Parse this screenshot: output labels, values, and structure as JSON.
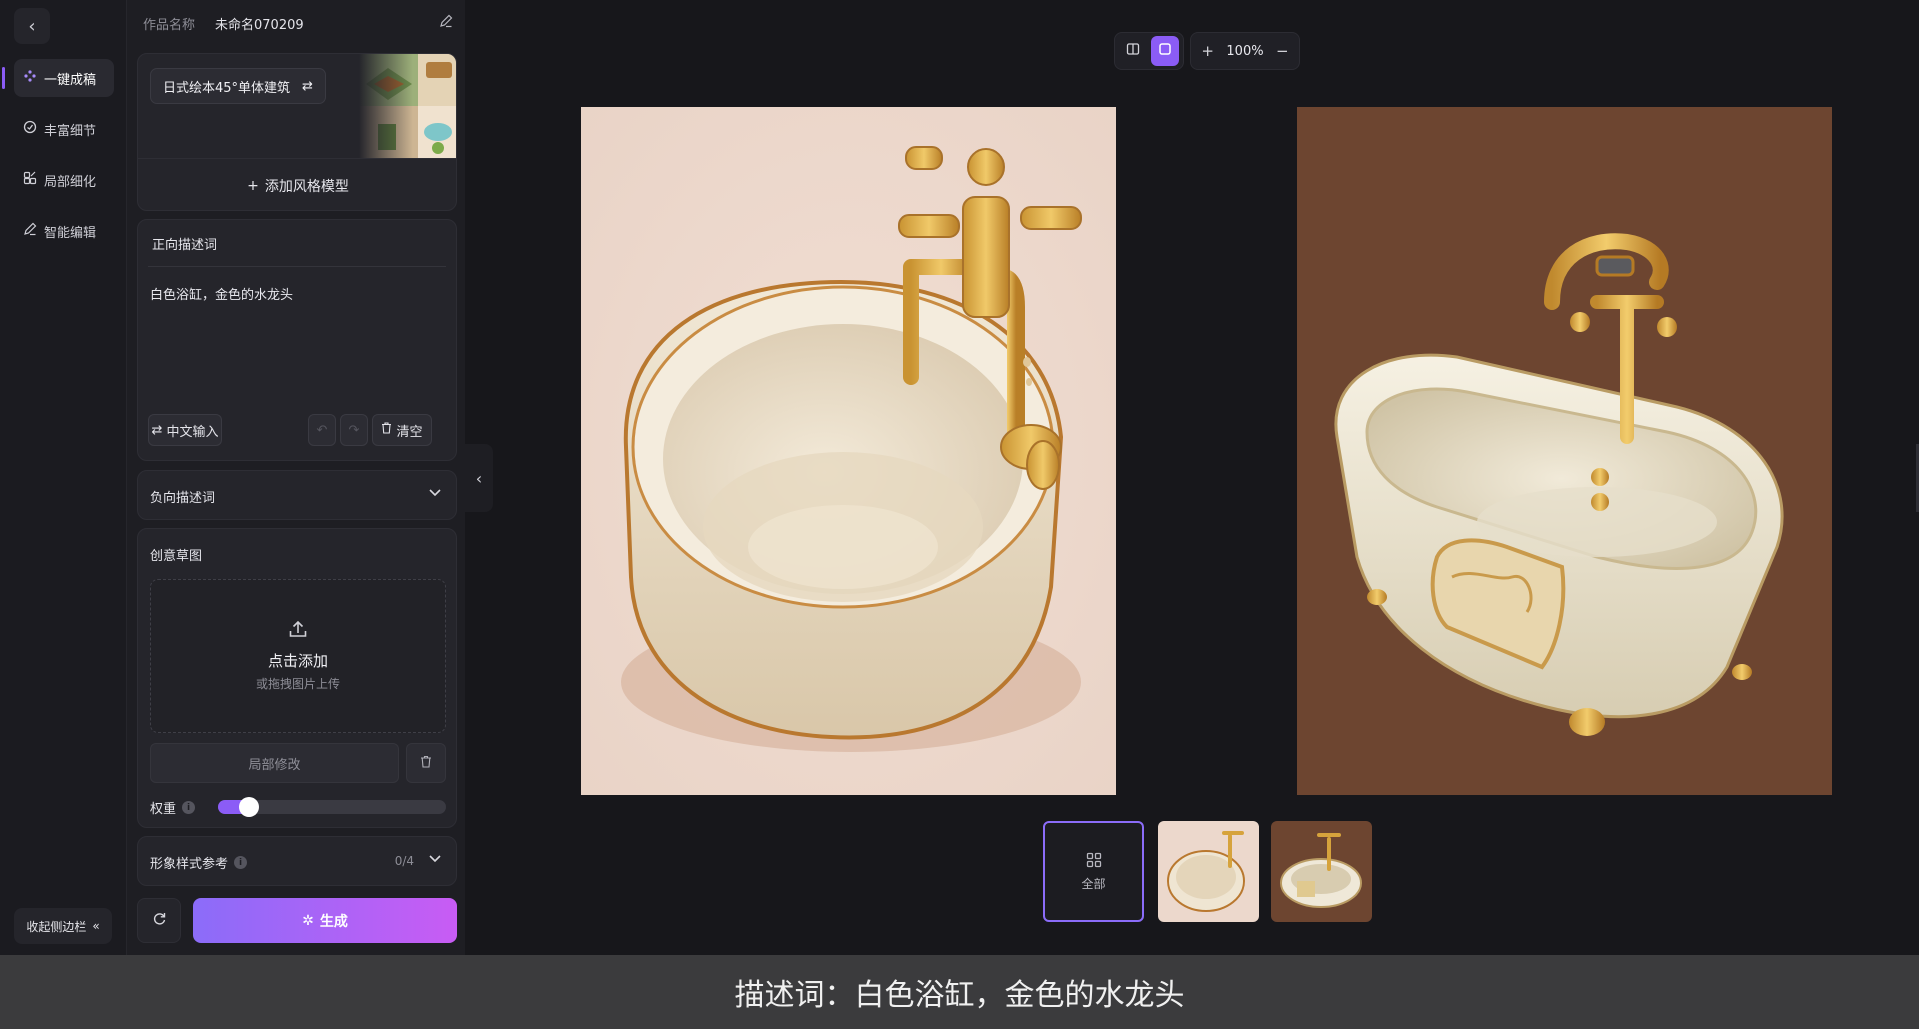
{
  "nav": {
    "items": [
      {
        "label": "一键成稿",
        "icon": "sparkle-dots-icon",
        "active": true
      },
      {
        "label": "丰富细节",
        "icon": "circle-check-icon",
        "active": false
      },
      {
        "label": "局部细化",
        "icon": "grid-edit-icon",
        "active": false
      },
      {
        "label": "智能编辑",
        "icon": "pencil-icon",
        "active": false
      }
    ],
    "collapse_label": "收起侧边栏"
  },
  "project": {
    "name_label": "作品名称",
    "name_value": "未命名070209"
  },
  "style": {
    "name": "日式绘本45°单体建筑",
    "add_label": "添加风格模型"
  },
  "prompt": {
    "title": "正向描述词",
    "text": "白色浴缸，金色的水龙头",
    "lang_button": "中文输入",
    "clear_button": "清空"
  },
  "negative": {
    "title": "负向描述词"
  },
  "sketch": {
    "title": "创意草图",
    "upload_main": "点击添加",
    "upload_sub": "或拖拽图片上传",
    "local_edit": "局部修改",
    "weight_label": "权重",
    "weight_value": 0.1
  },
  "reference": {
    "title": "形象样式参考",
    "count": "0/4"
  },
  "generate_label": "生成",
  "toolbar": {
    "zoom": "100%"
  },
  "thumbs": {
    "all_label": "全部"
  },
  "colors": {
    "accent": "#8b5cf6",
    "gradient_end": "#c85cf4",
    "brown_bg": "#6d4530",
    "pink_bg": "#ecd8cc",
    "gold": "#d6a33c"
  },
  "caption": "描述词：白色浴缸，金色的水龙头"
}
